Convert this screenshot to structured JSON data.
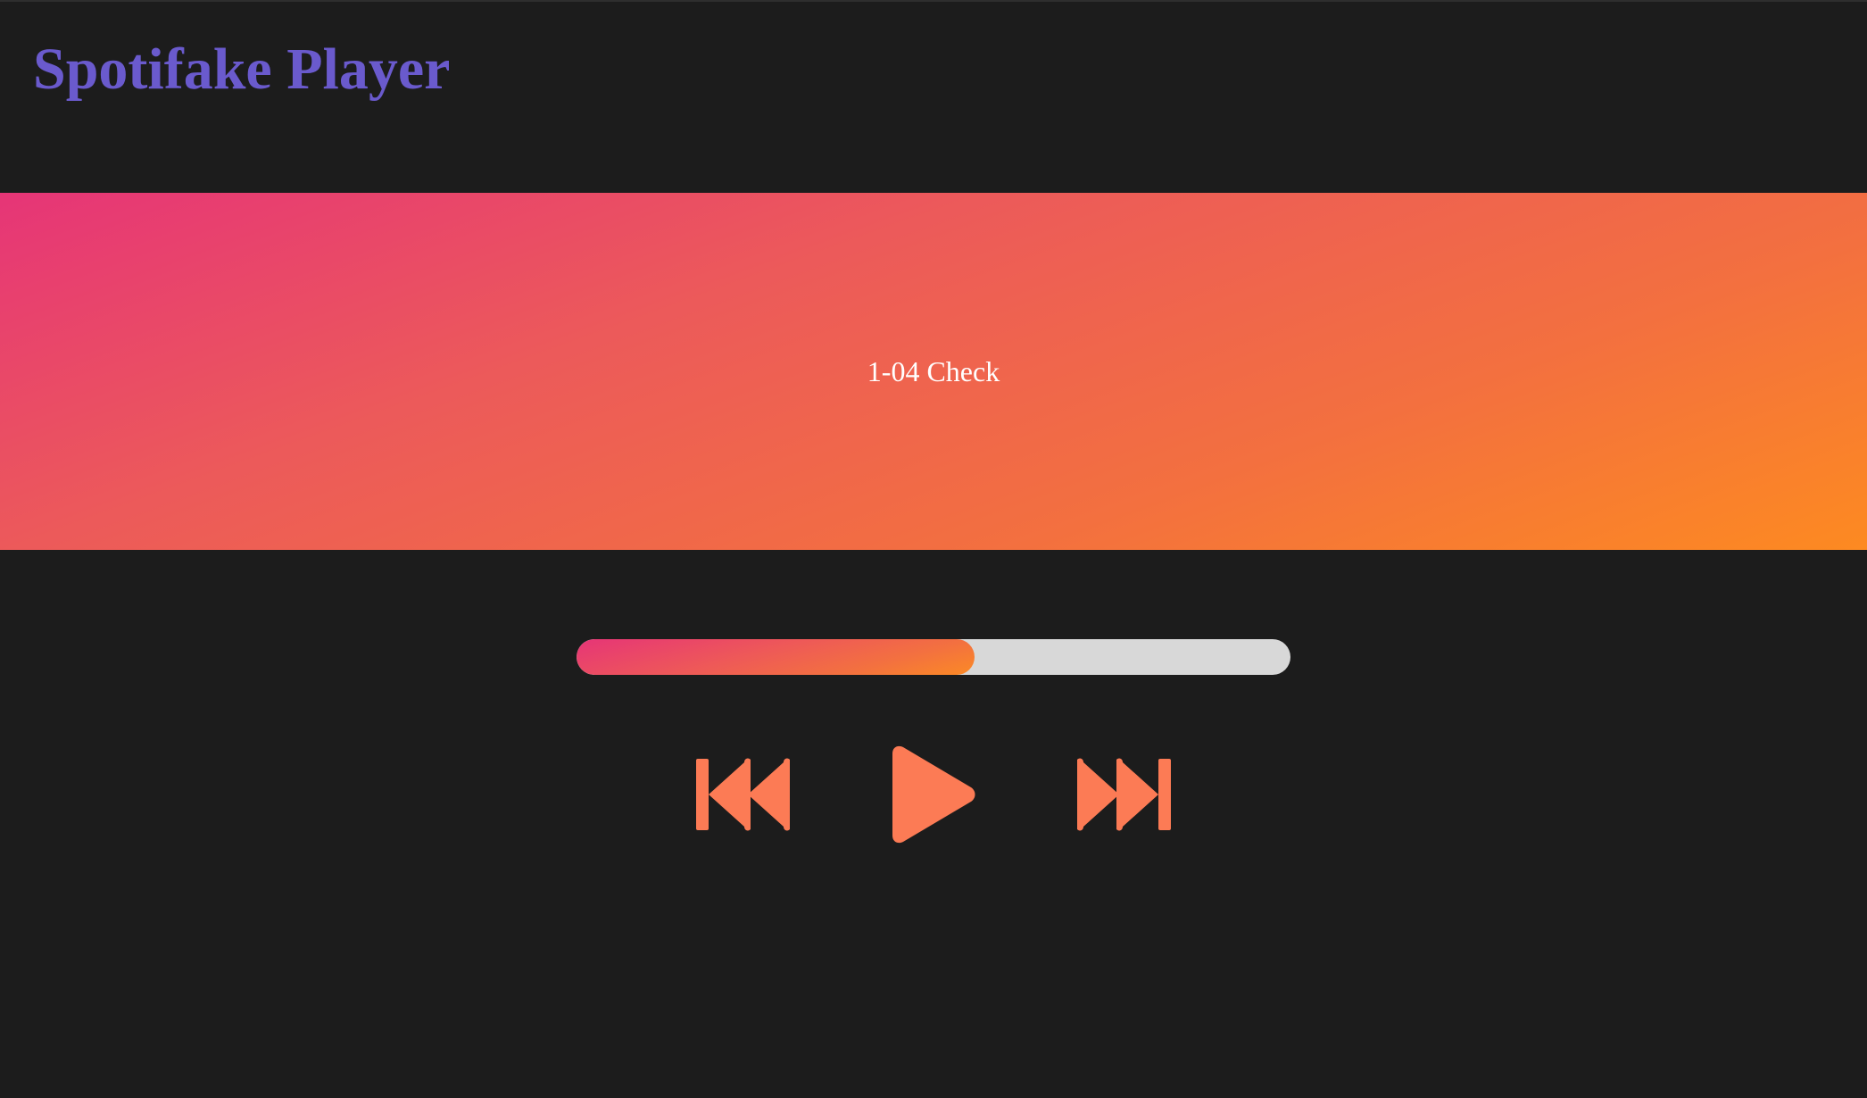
{
  "app": {
    "title": "Spotifake Player"
  },
  "now_playing": {
    "track_name": "1-04 Check"
  },
  "progress": {
    "fraction": 0.557
  },
  "controls": {
    "previous_icon": "skip-previous-icon",
    "play_icon": "play-icon",
    "next_icon": "skip-next-icon",
    "icon_color": "#fc7b55"
  },
  "colors": {
    "background": "#1c1c1c",
    "title": "#6a5acd",
    "gradient_start": "#e63577",
    "gradient_end": "#fd8a21",
    "progress_track": "#d8d8d8"
  }
}
